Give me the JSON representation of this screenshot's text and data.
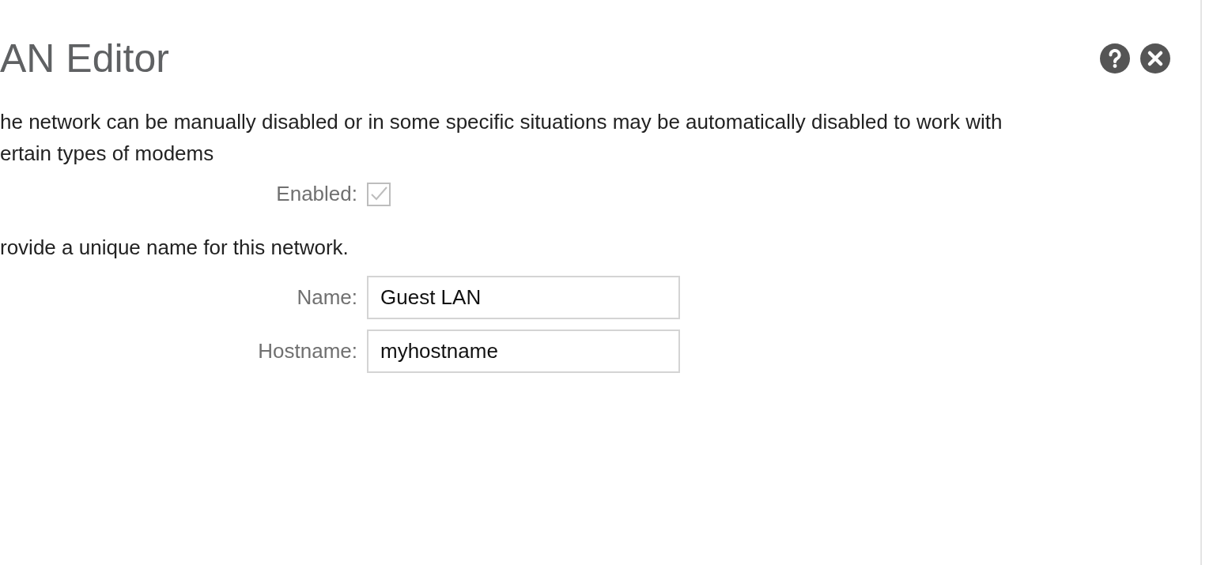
{
  "dialog": {
    "title": "AN Editor",
    "sections": [
      {
        "description": [
          "he network can be manually disabled or in some specific situations may be automatically disabled to work with",
          "ertain types of modems"
        ],
        "fields": [
          {
            "kind": "checkbox",
            "label": "Enabled:",
            "checked": true,
            "disabled": true
          }
        ]
      },
      {
        "description": [
          "rovide a unique name for this network."
        ],
        "fields": [
          {
            "kind": "text",
            "label": "Name:",
            "value": "Guest LAN"
          },
          {
            "kind": "text",
            "label": "Hostname:",
            "value": "myhostname"
          }
        ]
      }
    ]
  }
}
